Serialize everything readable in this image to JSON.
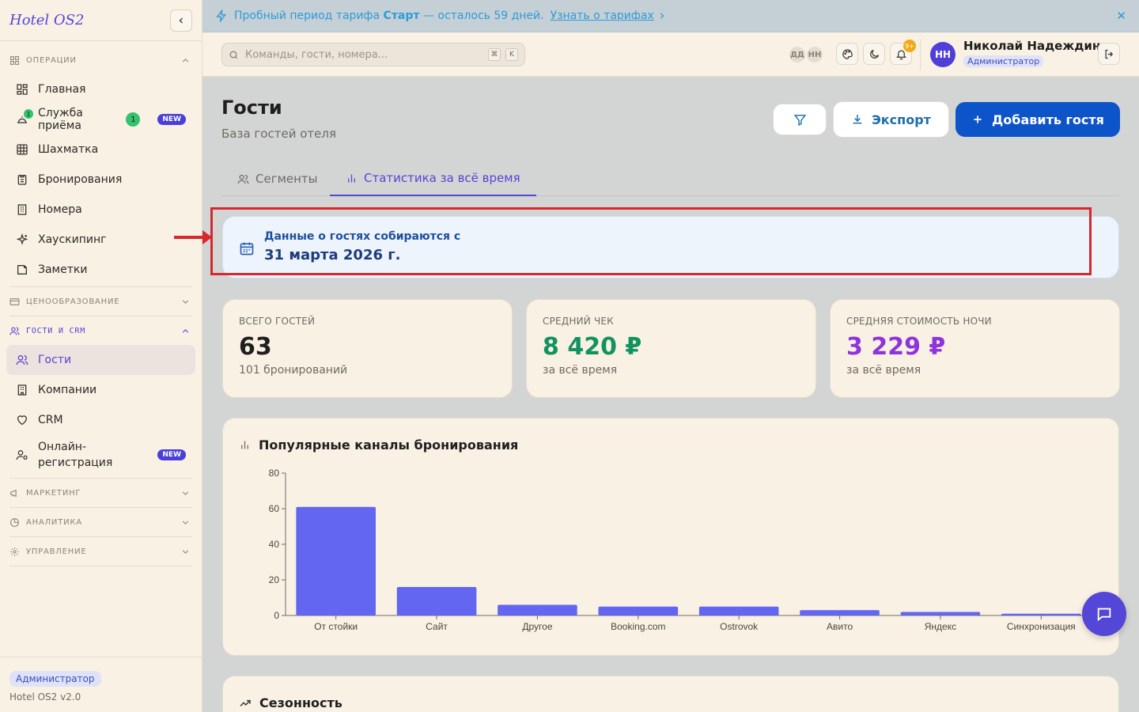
{
  "sidebar": {
    "brand": "Hotel OS2",
    "sections": {
      "operations": "ОПЕРАЦИИ",
      "pricing": "ЦЕНООБРАЗОВАНИЕ",
      "guests_crm": "ГОСТИ И CRM",
      "marketing": "МАРКЕТИНГ",
      "analytics": "АНАЛИТИКА",
      "management": "УПРАВЛЕНИЕ"
    },
    "items": {
      "home": "Главная",
      "reception": "Служба приёма",
      "reception_dot": "1",
      "reception_count": "1",
      "reception_new": "NEW",
      "chess": "Шахматка",
      "bookings": "Бронирования",
      "rooms": "Номера",
      "housekeeping": "Хаускипинг",
      "notes": "Заметки",
      "guests": "Гости",
      "companies": "Компании",
      "crm": "CRM",
      "online_reg": "Онлайн-регистрация",
      "online_reg_new": "NEW"
    },
    "footer": {
      "role": "Администратор",
      "version": "Hotel OS2 v2.0"
    }
  },
  "banner": {
    "text_before": "Пробный период тарифа ",
    "plan": "Старт",
    "text_after": " — осталось 59 дней.",
    "link": "Узнать о тарифах",
    "close": "✕"
  },
  "topbar": {
    "search_placeholder": "Команды, гости, номера...",
    "kbd1": "⌘",
    "kbd2": "K",
    "initials": [
      "ДД",
      "НН"
    ],
    "notif_count": "9+",
    "avatar": "НН",
    "user_name": "Николай Надеждин",
    "user_role": "Администратор"
  },
  "page": {
    "title": "Гости",
    "subtitle": "База гостей отеля",
    "export_label": "Экспорт",
    "add_label": "Добавить гостя",
    "tabs": [
      "Сегменты",
      "Статистика за всё время"
    ]
  },
  "info": {
    "label": "Данные о гостях собираются с",
    "date": "31 марта 2026 г."
  },
  "stats": [
    {
      "label": "ВСЕГО ГОСТЕЙ",
      "value": "63",
      "sub": "101 бронирований",
      "color": "#1f1f1f"
    },
    {
      "label": "СРЕДНИЙ ЧЕК",
      "value": "8 420 ₽",
      "sub": "за всё время",
      "color": "#11925f"
    },
    {
      "label": "СРЕДНЯЯ СТОИМОСТЬ НОЧИ",
      "value": "3 229 ₽",
      "sub": "за всё время",
      "color": "#8f34dc"
    }
  ],
  "chart_data": {
    "type": "bar",
    "title": "Популярные каналы бронирования",
    "categories": [
      "От стойки",
      "Сайт",
      "Другое",
      "Booking.com",
      "Ostrovok",
      "Авито",
      "Яндекс",
      "Синхронизация"
    ],
    "values": [
      61,
      16,
      6,
      5,
      5,
      3,
      2,
      1
    ],
    "ylim": [
      0,
      80
    ],
    "yticks": [
      0,
      20,
      40,
      60,
      80
    ],
    "bar_color": "#6366f1"
  },
  "seasonality": {
    "title": "Сезонность"
  },
  "colors": {
    "accent": "#5446d6",
    "primary_button": "#0d54c9",
    "highlight": "#d6282d"
  }
}
